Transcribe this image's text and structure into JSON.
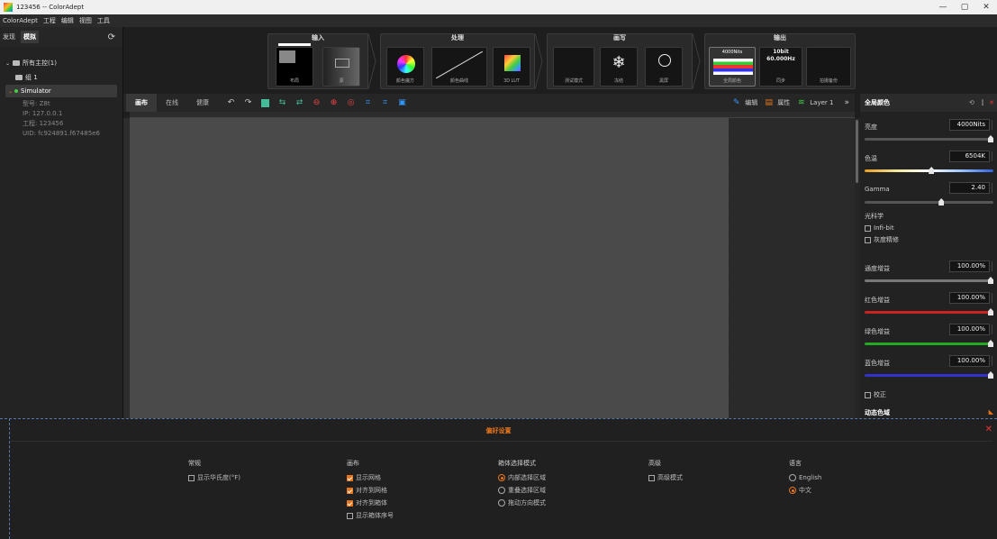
{
  "window": {
    "title": "123456 -- ColorAdept",
    "min": "—",
    "max": "▢",
    "close": "✕"
  },
  "menu": [
    "ColorAdept",
    "工程",
    "编辑",
    "视图",
    "工具"
  ],
  "left": {
    "tabs": [
      "发现",
      "模拟"
    ],
    "group_label": "所有主控(1)",
    "subgroup": "组 1",
    "device": {
      "name": "Simulator",
      "model": "型号: Z8t",
      "ip": "IP: 127.0.0.1",
      "project": "工程: 123456",
      "uid": "UID: fc924891.f67485e6"
    }
  },
  "pipeline": {
    "stages": [
      {
        "title": "输入",
        "tiles": [
          "布局",
          "源"
        ]
      },
      {
        "title": "处理",
        "tiles": [
          "颜色魔方",
          "颜色曲线",
          "3D LUT"
        ]
      },
      {
        "title": "画写",
        "tiles": [
          "测试模式",
          "冻结",
          "黑屏"
        ]
      },
      {
        "title": "输出",
        "tiles": [
          "全局颜色",
          "同步",
          "拍摄备份"
        ]
      }
    ],
    "output_nits": "4000Nits",
    "output_bit": "10bit",
    "output_hz": "60.000Hz"
  },
  "toolbar": {
    "tabs": [
      "画布",
      "在线",
      "健康"
    ],
    "edit": "编辑",
    "props": "属性",
    "layer": "Layer 1"
  },
  "right": {
    "title": "全局颜色",
    "brightness": {
      "label": "亮度",
      "value": "4000Nits",
      "level": 1.0
    },
    "temp": {
      "label": "色温",
      "value": "6504K",
      "level": 0.52
    },
    "gamma": {
      "label": "Gamma",
      "value": "2.40",
      "level": 0.6
    },
    "optics_label": "光科学",
    "infibit": "Infi-bit",
    "gray_fine": "灰度精修",
    "gain": {
      "label": "通度增益",
      "value": "100.00%",
      "level": 1.0
    },
    "red": {
      "label": "红色增益",
      "value": "100.00%",
      "level": 1.0
    },
    "green": {
      "label": "绿色增益",
      "value": "100.00%",
      "level": 1.0
    },
    "blue": {
      "label": "蓝色增益",
      "value": "100.00%",
      "level": 1.0
    },
    "correct": "校正",
    "dynamic": "动态色域"
  },
  "prefs": {
    "title": "偏好设置",
    "general": {
      "h": "常规",
      "items": [
        "显示华氏度(°F)"
      ]
    },
    "canvas": {
      "h": "画布",
      "items": [
        "显示网格",
        "对齐到网格",
        "对齐到箱体",
        "显示箱体序号"
      ]
    },
    "cabinet": {
      "h": "箱体选择模式",
      "items": [
        "内部选择区域",
        "重叠选择区域",
        "拖动方向模式"
      ]
    },
    "advanced": {
      "h": "高级",
      "items": [
        "高级模式"
      ]
    },
    "language": {
      "h": "语言",
      "items": [
        "English",
        "中文"
      ]
    }
  },
  "colors": {
    "accent": "#e8751a",
    "bg": "#1e1e1e",
    "canvas": "#4a4a4a"
  }
}
